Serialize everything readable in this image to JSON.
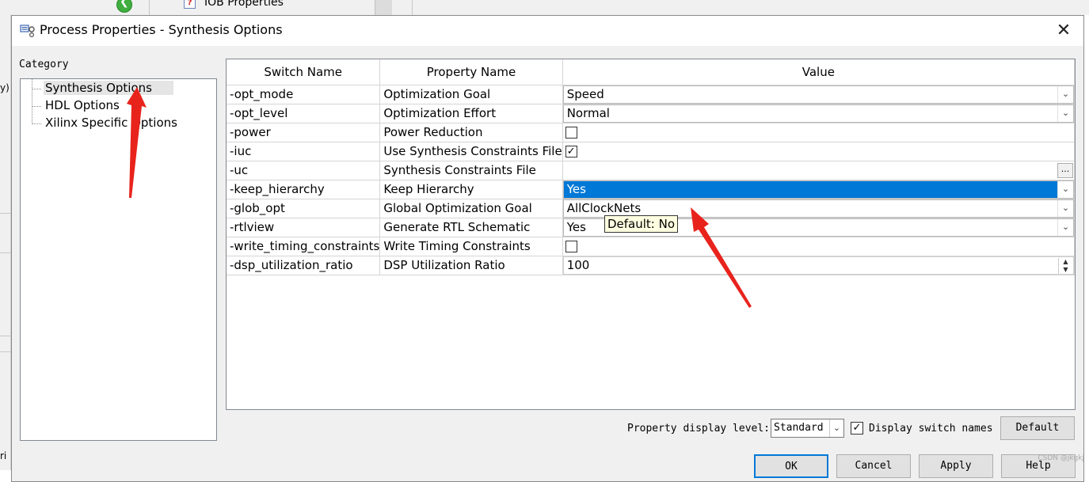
{
  "background": {
    "tree_item": "IOB Properties",
    "left_fragments": [
      "y)",
      "ri"
    ]
  },
  "dialog": {
    "title": "Process Properties - Synthesis Options",
    "close_glyph": "✕"
  },
  "category": {
    "label": "Category",
    "items": [
      {
        "label": "Synthesis Options",
        "selected": true
      },
      {
        "label": "HDL Options",
        "selected": false
      },
      {
        "label": "Xilinx Specific Options",
        "selected": false
      }
    ]
  },
  "grid": {
    "headers": [
      "Switch Name",
      "Property Name",
      "Value"
    ],
    "rows": [
      {
        "switch": "-opt_mode",
        "property": "Optimization Goal",
        "type": "combo",
        "value": "Speed"
      },
      {
        "switch": "-opt_level",
        "property": "Optimization Effort",
        "type": "combo",
        "value": "Normal"
      },
      {
        "switch": "-power",
        "property": "Power Reduction",
        "type": "checkbox",
        "checked": false
      },
      {
        "switch": "-iuc",
        "property": "Use Synthesis Constraints File",
        "type": "checkbox",
        "checked": true
      },
      {
        "switch": "-uc",
        "property": "Synthesis Constraints File",
        "type": "file",
        "value": "",
        "browse_label": "..."
      },
      {
        "switch": "-keep_hierarchy",
        "property": "Keep Hierarchy",
        "type": "combo",
        "value": "Yes",
        "selected": true
      },
      {
        "switch": "-glob_opt",
        "property": "Global Optimization Goal",
        "type": "combo",
        "value": "AllClockNets"
      },
      {
        "switch": "-rtlview",
        "property": "Generate RTL Schematic",
        "type": "combo",
        "value": "Yes"
      },
      {
        "switch": "-write_timing_constraints",
        "property": "Write Timing Constraints",
        "type": "checkbox",
        "checked": false
      },
      {
        "switch": "-dsp_utilization_ratio",
        "property": "DSP Utilization Ratio",
        "type": "spin",
        "value": "100"
      }
    ]
  },
  "tooltip": "Default: No",
  "footer": {
    "display_level_label": "Property display level:",
    "display_level_value": "Standard",
    "display_switch_names_label": "Display switch names",
    "display_switch_names_checked": true,
    "default_button": "Default",
    "ok_button": "OK",
    "cancel_button": "Cancel",
    "apply_button": "Apply",
    "help_button": "Help"
  },
  "watermark": "CSDN @jkgkj",
  "colors": {
    "selection": "#0078d7",
    "annotation_arrow": "#e8231c",
    "tooltip_bg": "#ffffe1"
  }
}
